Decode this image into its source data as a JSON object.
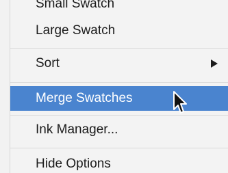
{
  "menu": {
    "items": [
      {
        "label": "Small Swatch"
      },
      {
        "label": "Large Swatch"
      },
      {
        "label": "Sort"
      },
      {
        "label": "Merge Swatches"
      },
      {
        "label": "Ink Manager..."
      },
      {
        "label": "Hide Options"
      }
    ]
  },
  "colors": {
    "highlight": "#4a84cf",
    "menu_background": "#f3f3f3",
    "separator": "#d9d9d9"
  },
  "icons": {
    "submenu": "chevron-right-icon",
    "pointer": "mouse-pointer-icon"
  }
}
